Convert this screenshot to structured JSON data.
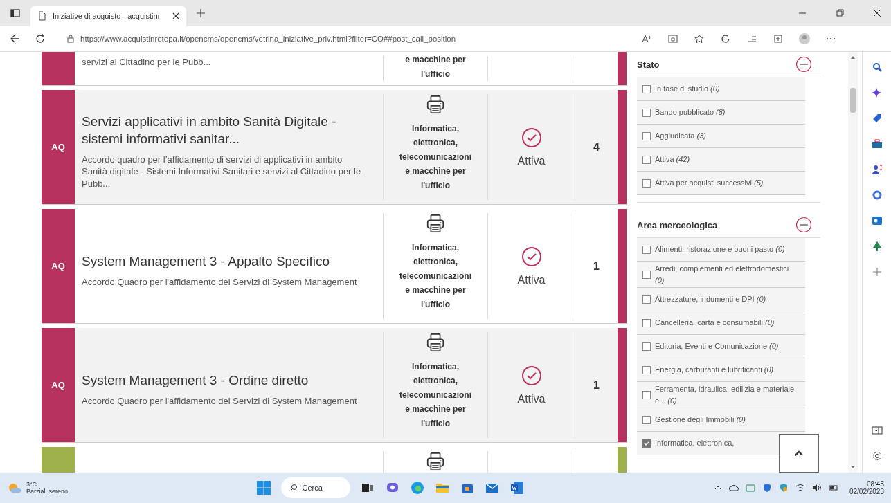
{
  "browser": {
    "tab_title": "Iniziative di acquisto - acquistinr",
    "url": "https://www.acquistinretepa.it/opencms/opencms/vetrina_iniziative_priv.html?filter=CO##post_call_position"
  },
  "results": [
    {
      "kind": "cut-top",
      "color": "#b8325f",
      "highlighted": false,
      "description": "servizi al Cittadino per le Pubb...",
      "category": "e macchine per l'ufficio"
    },
    {
      "kind": "full",
      "color": "#b8325f",
      "highlighted": true,
      "type_label": "AQ",
      "title": "Servizi applicativi in ambito Sanità Digitale - sistemi informativi sanitar...",
      "description": "Accordo quadro per l’affidamento di servizi di applicativi in ambito Sanità digitale - Sistemi Informativi Sanitari e servizi al Cittadino per le Pubb...",
      "category": "Informatica, elettronica, telecomunicazioni e macchine per l'ufficio",
      "status": "Attiva",
      "count": "4"
    },
    {
      "kind": "full",
      "color": "#b8325f",
      "highlighted": false,
      "type_label": "AQ",
      "title": "System Management 3 - Appalto Specifico",
      "description": "Accordo Quadro per l'affidamento dei Servizi di System Management",
      "category": "Informatica, elettronica, telecomunicazioni e macchine per l'ufficio",
      "status": "Attiva",
      "count": "1"
    },
    {
      "kind": "full",
      "color": "#b8325f",
      "highlighted": true,
      "type_label": "AQ",
      "title": "System Management 3 - Ordine diretto",
      "description": "Accordo Quadro per l'affidamento dei Servizi di System Management",
      "category": "Informatica, elettronica, telecomunicazioni e macchine per l'ufficio",
      "status": "Attiva",
      "count": "1"
    },
    {
      "kind": "cut-bottom",
      "color": "#9db04c",
      "highlighted": false
    }
  ],
  "filters": [
    {
      "title": "Stato",
      "expanded": true,
      "items": [
        {
          "label": "In fase di studio *(0)*",
          "checked": false
        },
        {
          "label": "Bando pubblicato *(8)*",
          "checked": false
        },
        {
          "label": "Aggiudicata *(3)*",
          "checked": false
        },
        {
          "label": "Attiva *(42)*",
          "checked": false
        },
        {
          "label": "Attiva per acquisti successivi *(5)*",
          "checked": false
        }
      ]
    },
    {
      "title": "Area merceologica",
      "expanded": true,
      "items": [
        {
          "label": "Alimenti, ristorazione e buoni pasto *(0)*",
          "checked": false
        },
        {
          "label": "Arredi, complementi ed elettrodomestici *(0)*",
          "checked": false
        },
        {
          "label": "Attrezzature, indumenti e DPI *(0)*",
          "checked": false
        },
        {
          "label": "Cancelleria, carta e consumabili *(0)*",
          "checked": false
        },
        {
          "label": "Editoria, Eventi e Comunicazione *(0)*",
          "checked": false
        },
        {
          "label": "Energia, carburanti e lubrificanti *(0)*",
          "checked": false
        },
        {
          "label": "Ferramenta, idraulica, edilizia e materiale e... *(0)*",
          "checked": false
        },
        {
          "label": "Gestione degli Immobili *(0)*",
          "checked": false
        },
        {
          "label": "Informatica, elettronica,",
          "checked": true
        }
      ]
    }
  ],
  "taskbar": {
    "temperature": "3°C",
    "weather": "Parzial. sereno",
    "search_placeholder": "Cerca",
    "time": "08:45",
    "date": "02/02/2023"
  }
}
